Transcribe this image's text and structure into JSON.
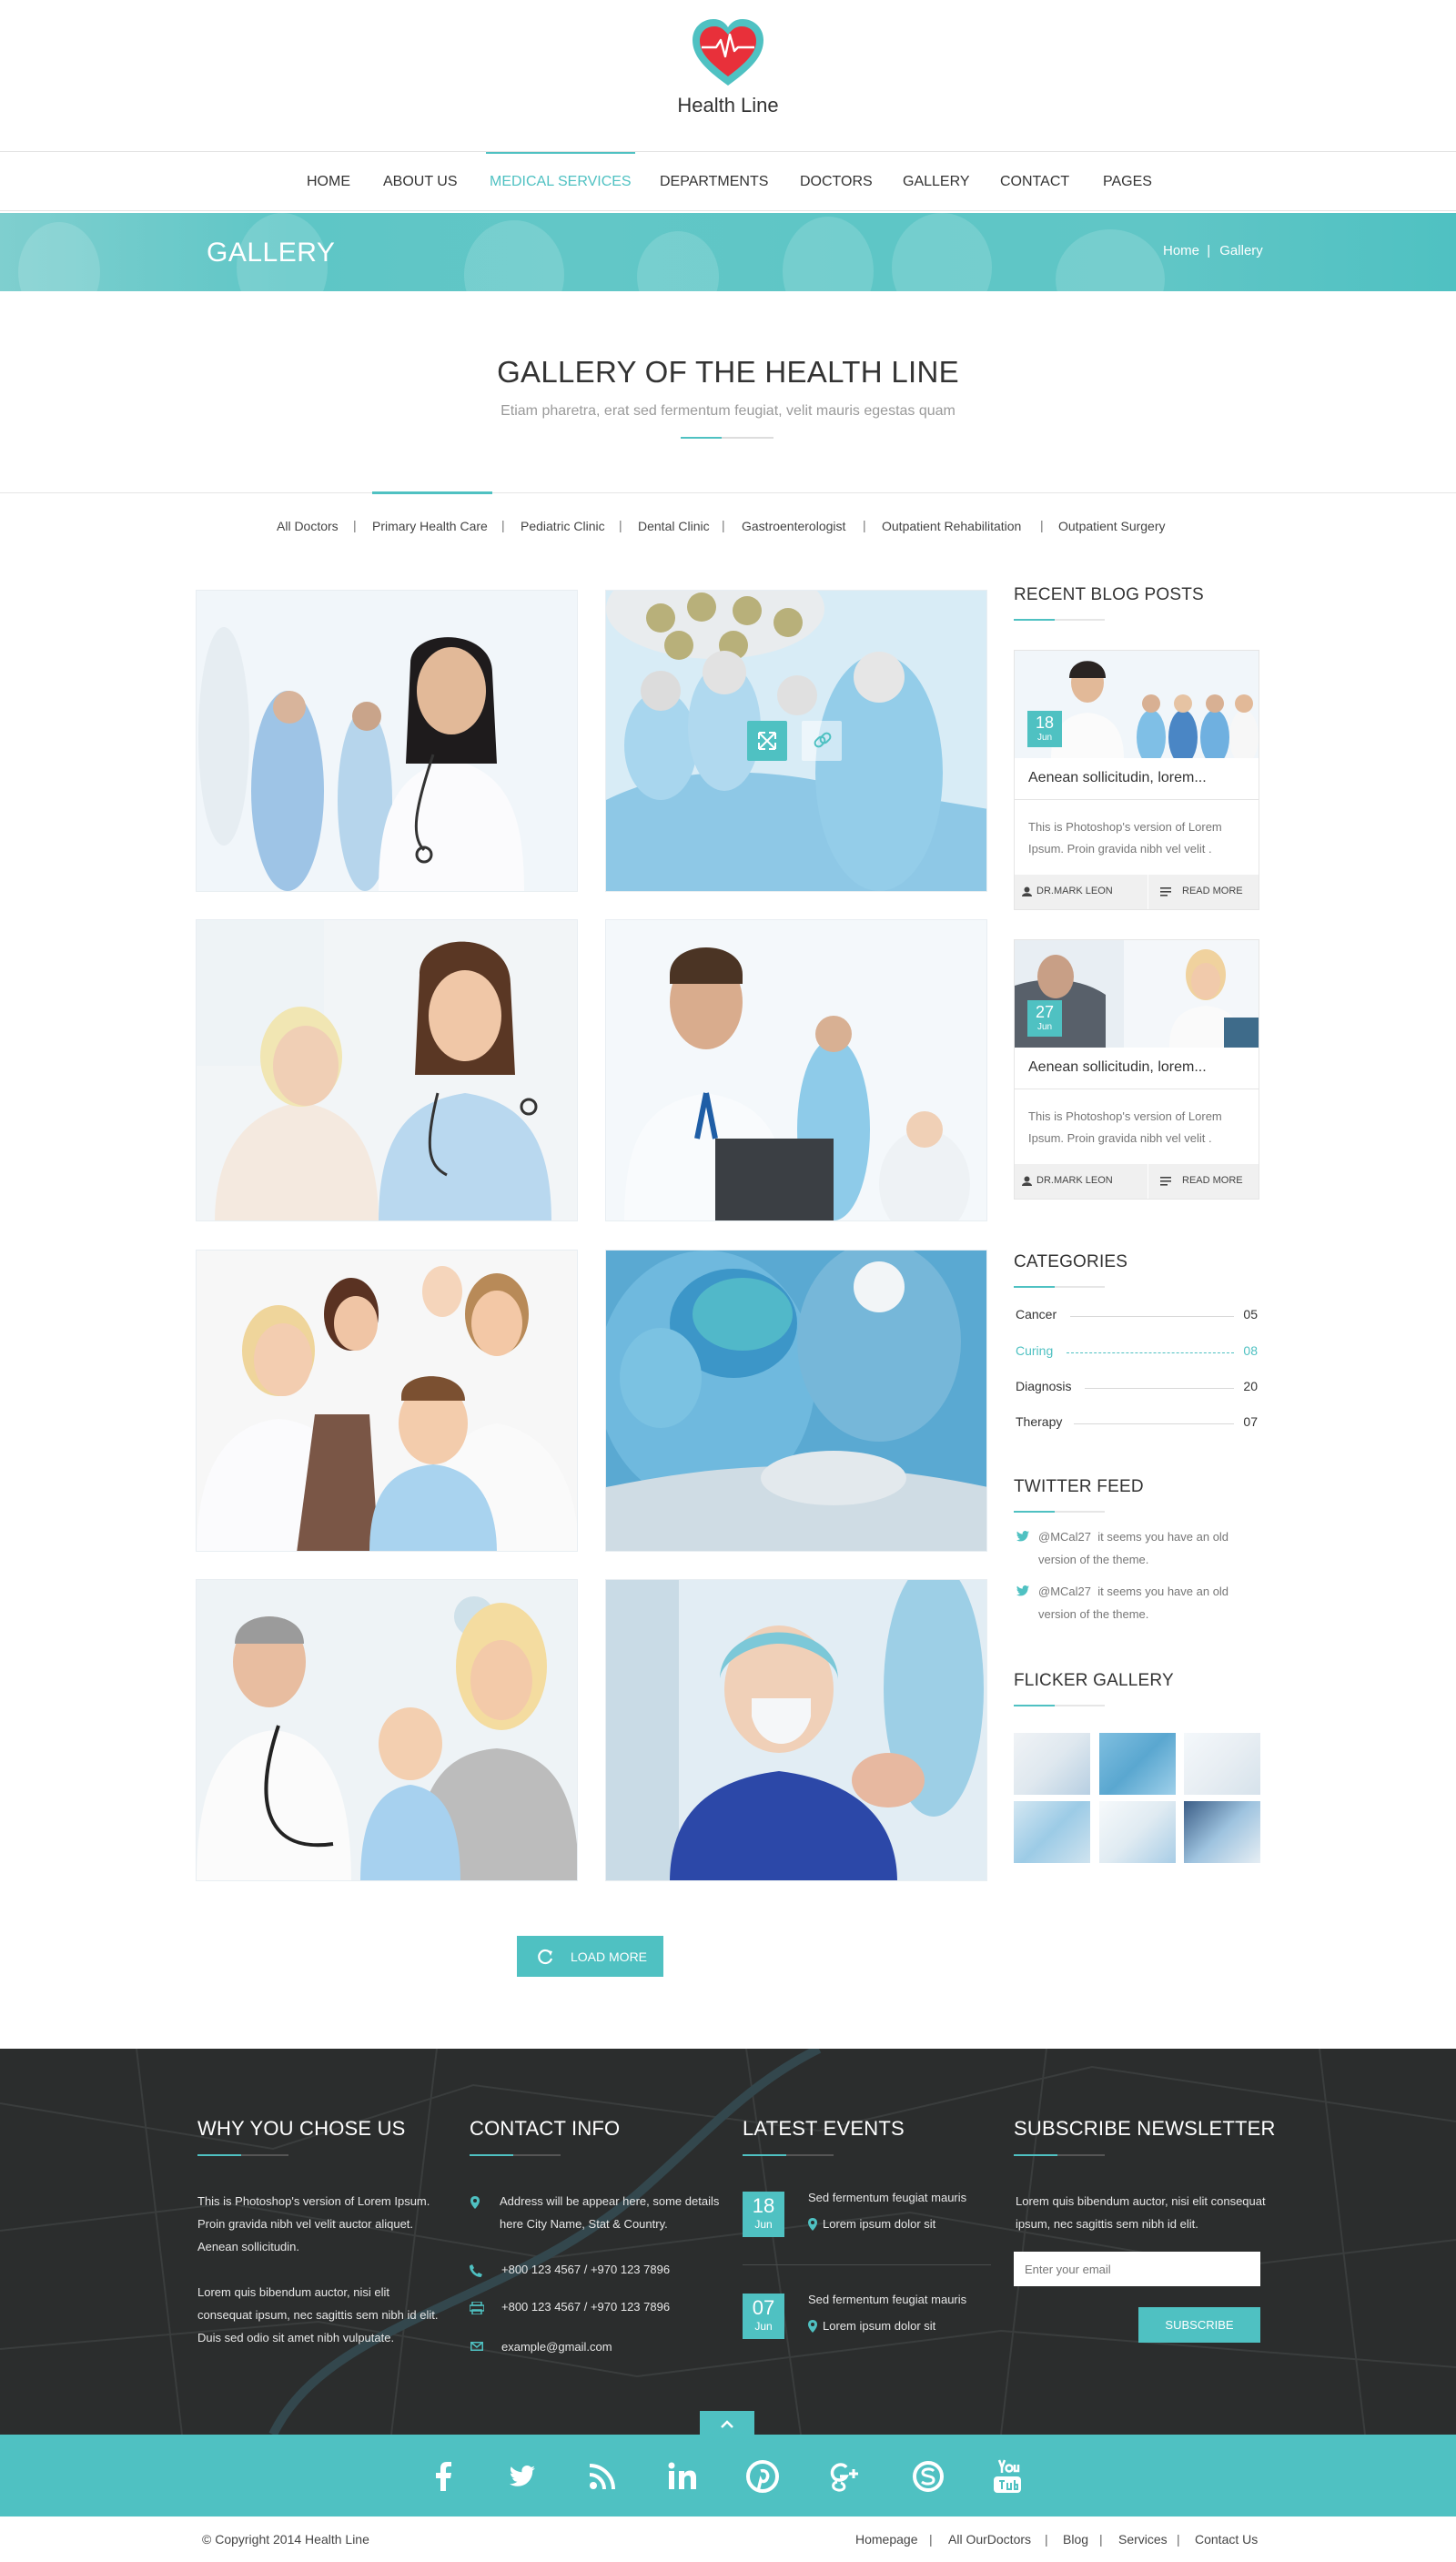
{
  "brand": {
    "name": "Health Line"
  },
  "nav": {
    "items": [
      "HOME",
      "ABOUT US",
      "MEDICAL SERVICES",
      "DEPARTMENTS",
      "DOCTORS",
      "GALLERY",
      "CONTACT",
      "PAGES"
    ],
    "active": "MEDICAL SERVICES"
  },
  "banner": {
    "title": "GALLERY",
    "breadcrumb_home": "Home",
    "breadcrumb_sep": "|",
    "breadcrumb_current": "Gallery"
  },
  "section": {
    "title": "GALLERY OF THE HEALTH LINE",
    "subtitle": "Etiam pharetra, erat sed fermentum feugiat, velit mauris egestas quam"
  },
  "filters": {
    "items": [
      "All Doctors",
      "Primary Health Care",
      "Pediatric Clinic",
      "Dental Clinic",
      "Gastroenterologist",
      "Outpatient Rehabilitation",
      "Outpatient Surgery"
    ],
    "active": "Primary Health Care",
    "separator": "|"
  },
  "gallery": {
    "load_more": "LOAD MORE"
  },
  "sidebar": {
    "recent_title": "RECENT BLOG POSTS",
    "posts": [
      {
        "day": "18",
        "month": "Jun",
        "title": "Aenean sollicitudin, lorem...",
        "text": "This is Photoshop's version  of Lorem Ipsum. Proin gravida nibh vel velit .",
        "author": "DR.MARK LEON",
        "more": "READ MORE"
      },
      {
        "day": "27",
        "month": "Jun",
        "title": "Aenean sollicitudin, lorem...",
        "text": "This is Photoshop's version  of Lorem Ipsum. Proin gravida nibh vel velit .",
        "author": "DR.MARK LEON",
        "more": "READ MORE"
      }
    ],
    "categories_title": "CATEGORIES",
    "categories": [
      {
        "name": "Cancer",
        "count": "05"
      },
      {
        "name": "Curing",
        "count": "08"
      },
      {
        "name": "Diagnosis",
        "count": "20"
      },
      {
        "name": "Therapy",
        "count": "07"
      }
    ],
    "active_category": "Curing",
    "twitter_title": "TWITTER FEED",
    "tweets": [
      {
        "handle": "@MCal27",
        "text": "it seems you have an old version of the theme."
      },
      {
        "handle": "@MCal27",
        "text": "it seems you have an old version of the theme."
      }
    ],
    "flicker_title": "FLICKER GALLERY"
  },
  "footer": {
    "why_title": "WHY YOU CHOSE US",
    "why_p1": "This is Photoshop's version  of Lorem Ipsum. Proin gravida nibh vel velit auctor aliquet. Aenean sollicitudin.",
    "why_p2": "Lorem quis bibendum auctor, nisi elit consequat ipsum, nec sagittis sem nibh id elit. Duis sed odio sit amet nibh vulputate.",
    "contact_title": "CONTACT INFO",
    "address": "Address will be appear here, some details here City Name, Stat & Country.",
    "phone": "+800 123 4567  /  +970 123 7896",
    "fax": "+800 123 4567  /  +970 123 7896",
    "email": "example@gmail.com",
    "events_title": "LATEST EVENTS",
    "events": [
      {
        "day": "18",
        "month": "Jun",
        "title": "Sed fermentum feugiat mauris",
        "place": "Lorem ipsum dolor sit"
      },
      {
        "day": "07",
        "month": "Jun",
        "title": "Sed fermentum feugiat mauris",
        "place": "Lorem ipsum dolor sit"
      }
    ],
    "newsletter_title": "SUBSCRIBE NEWSLETTER",
    "newsletter_text": "Lorem quis bibendum auctor, nisi elit consequat ipsum, nec sagittis sem nibh id elit.",
    "email_placeholder": "Enter your email",
    "subscribe": "SUBSCRIBE"
  },
  "social": {
    "icons": [
      "facebook-icon",
      "twitter-icon",
      "rss-icon",
      "linkedin-icon",
      "pinterest-icon",
      "google-plus-icon",
      "skype-icon",
      "youtube-icon"
    ]
  },
  "bottom": {
    "copyright": "© Copyright 2014 Health Line",
    "links": [
      "Homepage",
      "All OurDoctors",
      "Blog",
      "Services",
      "Contact Us"
    ],
    "separator": "|"
  },
  "colors": {
    "accent": "#4fc1c2",
    "footer_bg": "#2b2d2d",
    "text": "#333333"
  }
}
